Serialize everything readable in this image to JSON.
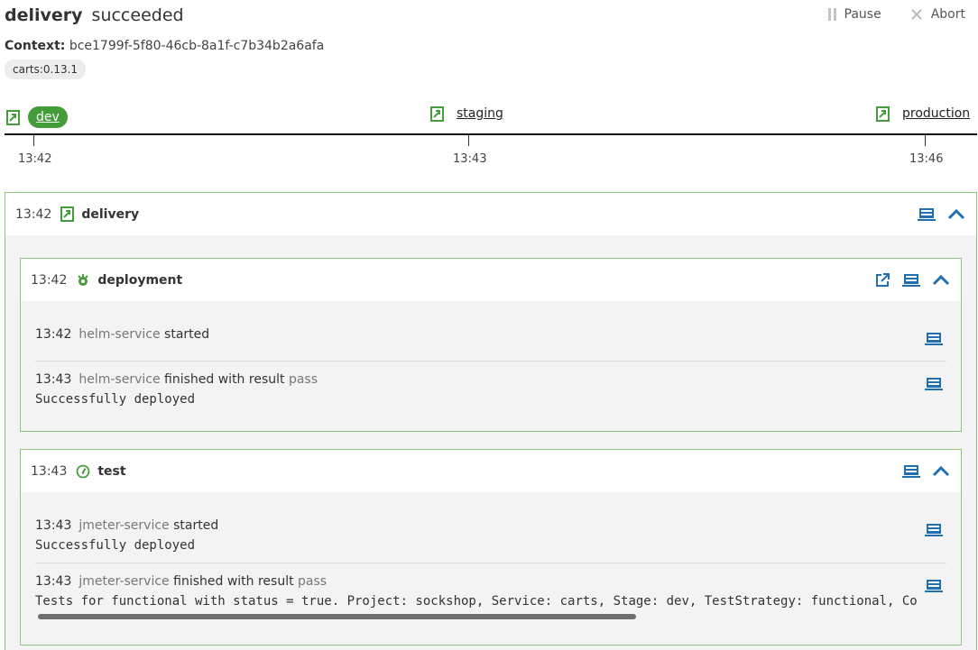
{
  "sequence": {
    "name": "delivery",
    "status": "succeeded"
  },
  "actions": {
    "pause": "Pause",
    "abort": "Abort"
  },
  "context": {
    "label": "Context:",
    "value": "bce1799f-5f80-46cb-8a1f-c7b34b2a6afa"
  },
  "tag": "carts:0.13.1",
  "stages": [
    {
      "name": "dev",
      "time": "13:42",
      "active": true
    },
    {
      "name": "staging",
      "time": "13:43",
      "active": false
    },
    {
      "name": "production",
      "time": "13:46",
      "active": false
    }
  ],
  "colors": {
    "accent_green": "#449c3a",
    "border_green": "#8ac47e",
    "icon_blue": "#1f6fb2"
  },
  "delivery_task": {
    "time": "13:42",
    "name": "delivery",
    "icon": "stage-link-icon",
    "subtasks": [
      {
        "time": "13:42",
        "name": "deployment",
        "icon": "helm-deploy-icon",
        "events": [
          {
            "time": "13:42",
            "service": "helm-service",
            "action": "started",
            "result": "",
            "message": ""
          },
          {
            "time": "13:43",
            "service": "helm-service",
            "action": "finished with result",
            "result": "pass",
            "message": "Successfully deployed"
          }
        ]
      },
      {
        "time": "13:43",
        "name": "test",
        "icon": "speedometer-icon",
        "events": [
          {
            "time": "13:43",
            "service": "jmeter-service",
            "action": "started",
            "result": "",
            "message": "Successfully deployed"
          },
          {
            "time": "13:43",
            "service": "jmeter-service",
            "action": "finished with result",
            "result": "pass",
            "message": "Tests for functional with status = true. Project: sockshop, Service: carts, Stage: dev, TestStrategy: functional, Co"
          }
        ]
      }
    ]
  }
}
